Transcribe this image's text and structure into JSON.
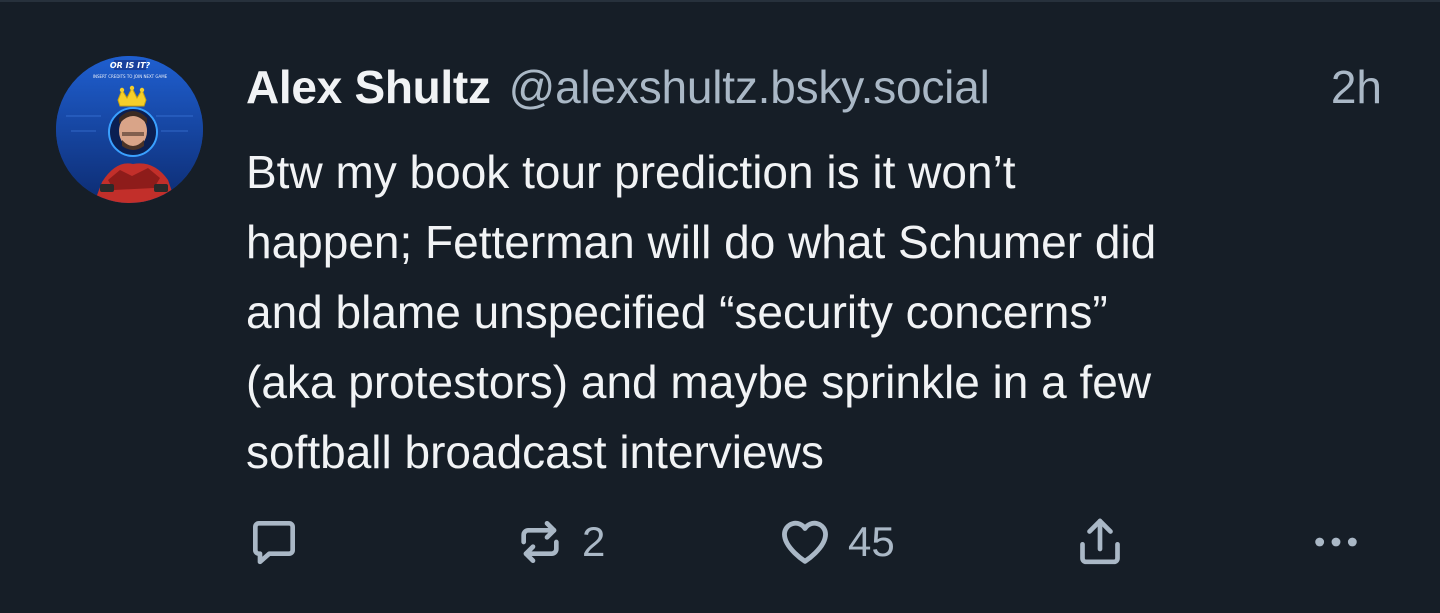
{
  "post": {
    "author": {
      "display_name": "Alex Shultz",
      "handle": "@alexshultz.bsky.social",
      "avatar_text": "OR IS IT? INSERT CREDITS TO JOIN NEXT GAME"
    },
    "timestamp": "2h",
    "text_lines": [
      "Btw my book tour prediction is it won’t",
      "happen; Fetterman will do what Schumer did",
      "and blame unspecified “security concerns”",
      "(aka protestors) and maybe sprinkle in a few",
      "softball broadcast interviews"
    ]
  },
  "actions": {
    "reply": {
      "icon": "reply-icon",
      "count": ""
    },
    "repost": {
      "icon": "repost-icon",
      "count": "2"
    },
    "like": {
      "icon": "heart-icon",
      "count": "45"
    },
    "share": {
      "icon": "share-icon"
    },
    "more": {
      "icon": "more-icon"
    }
  },
  "colors": {
    "background": "#161e27",
    "primary_text": "#f1f3f5",
    "secondary_text": "#aab8c6"
  }
}
